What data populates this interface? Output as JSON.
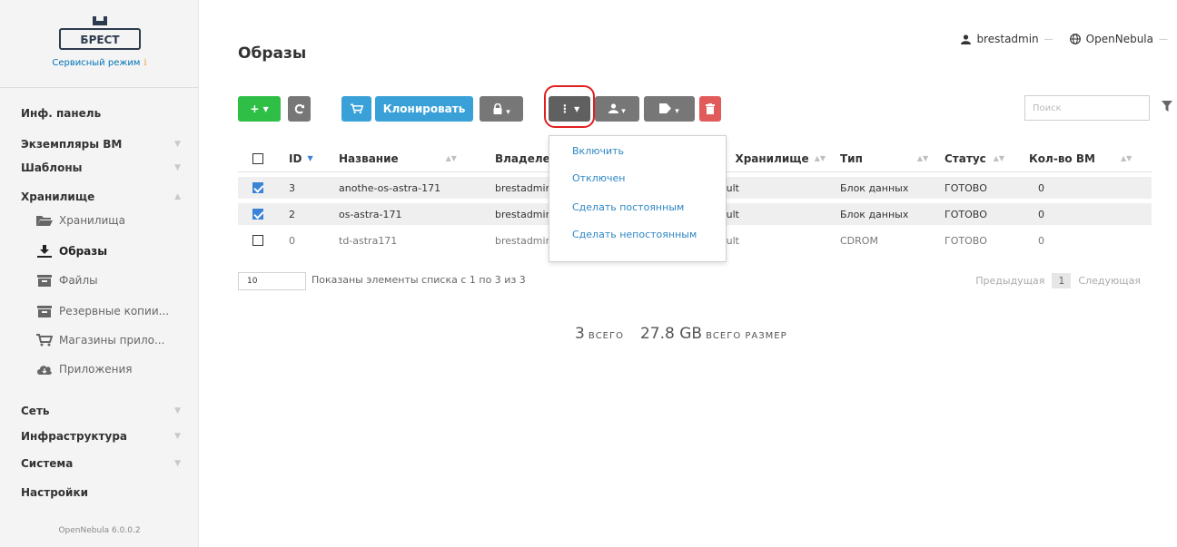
{
  "app": {
    "logo_text": "БРЕСТ",
    "mode_label": "Сервисный режим",
    "mode_info_icon": "i",
    "version": "OpenNebula 6.0.0.2"
  },
  "header": {
    "title": "Образы",
    "user": "brestadmin",
    "zone": "OpenNebula"
  },
  "sidebar": {
    "items": [
      {
        "label": "Инф. панель",
        "expandable": false
      },
      {
        "label": "Экземпляры ВМ",
        "expandable": true
      },
      {
        "label": "Шаблоны",
        "expandable": true
      },
      {
        "label": "Хранилище",
        "expandable": true,
        "expanded": true
      },
      {
        "label": "Сеть",
        "expandable": true
      },
      {
        "label": "Инфраструктура",
        "expandable": true
      },
      {
        "label": "Система",
        "expandable": true
      },
      {
        "label": "Настройки",
        "expandable": false
      }
    ],
    "storage_children": [
      {
        "label": "Хранилища",
        "icon": "folder-icon"
      },
      {
        "label": "Образы",
        "icon": "download-icon",
        "active": true
      },
      {
        "label": "Файлы",
        "icon": "archive-icon"
      },
      {
        "label": "Резервные копии...",
        "icon": "archive-icon"
      },
      {
        "label": "Магазины прило...",
        "icon": "cart-icon"
      },
      {
        "label": "Приложения",
        "icon": "cloud-icon"
      }
    ]
  },
  "toolbar": {
    "clone_label": "Клонировать",
    "search_placeholder": "Поиск",
    "colors": {
      "green": "#2fbf46",
      "blue": "#3aa1d8",
      "gray": "#777777",
      "red": "#e15b5b",
      "highlight": "#e02020"
    }
  },
  "dropdown": {
    "items": [
      "Включить",
      "Отключен",
      "Сделать постоянным",
      "Сделать непостоянным"
    ]
  },
  "table": {
    "headers": [
      "ID",
      "Название",
      "Владелец",
      "Хранилище",
      "Тип",
      "Статус",
      "Кол-во ВМ"
    ],
    "rows": [
      {
        "checked": true,
        "id": "3",
        "name": "anothe-os-astra-171",
        "owner": "brestadmin",
        "datastore": "default",
        "type": "Блок данных",
        "status": "ГОТОВО",
        "vms": "0"
      },
      {
        "checked": true,
        "id": "2",
        "name": "os-astra-171",
        "owner": "brestadmin",
        "datastore": "default",
        "type": "Блок данных",
        "status": "ГОТОВО",
        "vms": "0"
      },
      {
        "checked": false,
        "id": "0",
        "name": "td-astra171",
        "owner": "brestadmin",
        "datastore": "default",
        "type": "CDROM",
        "status": "ГОТОВО",
        "vms": "0"
      }
    ]
  },
  "footer": {
    "page_size": "10",
    "showing": "Показаны элементы списка с 1 по 3 из 3",
    "prev": "Предыдущая",
    "page": "1",
    "next": "Следующая"
  },
  "totals": {
    "count": "3",
    "count_label": "ВСЕГО",
    "size": "27.8 GB",
    "size_label": "ВСЕГО РАЗМЕР"
  }
}
